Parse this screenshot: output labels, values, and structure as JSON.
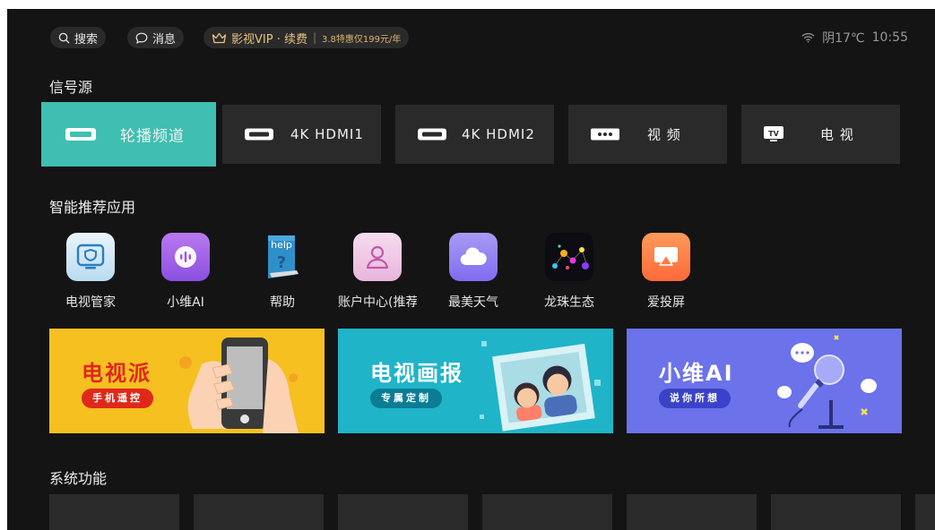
{
  "topbar": {
    "search_label": "搜索",
    "message_label": "消息",
    "vip_title": "影视VIP · 续费",
    "vip_offer": "3.8特惠仅199元/年",
    "weather": "阴17℃",
    "time": "10:55"
  },
  "sources": {
    "title": "信号源",
    "items": [
      {
        "label": "轮播频道",
        "icon": "hdmi-icon"
      },
      {
        "label": "4K HDMI1",
        "icon": "hdmi-icon"
      },
      {
        "label": "4K HDMI2",
        "icon": "hdmi-icon"
      },
      {
        "label": "视 频",
        "icon": "av-icon"
      },
      {
        "label": "电 视",
        "icon": "tv-icon"
      }
    ]
  },
  "apps": {
    "title": "智能推荐应用",
    "items": [
      {
        "name": "电视管家",
        "icon": "tv-manager-icon"
      },
      {
        "name": "小维AI",
        "icon": "voice-assistant-icon"
      },
      {
        "name": "帮助",
        "icon": "help-book-icon"
      },
      {
        "name": "账户中心(推荐",
        "icon": "account-icon"
      },
      {
        "name": "最美天气",
        "icon": "cloud-weather-icon"
      },
      {
        "name": "龙珠生态",
        "icon": "dragonball-icon"
      },
      {
        "name": "爱投屏",
        "icon": "screen-cast-icon"
      }
    ]
  },
  "banners": [
    {
      "title": "电视派",
      "subtitle": "手机遥控",
      "color": "#f6c021"
    },
    {
      "title": "电视画报",
      "subtitle": "专属定制",
      "color": "#1fb4c8"
    },
    {
      "title": "小维AI",
      "subtitle": "说你所想",
      "color": "#6b72ea"
    }
  ],
  "system": {
    "title": "系统功能"
  },
  "colors": {
    "accent": "#3fbfb1",
    "tile_bg": "#2a2a2a",
    "background": "#141414",
    "vip_gold": "#e8c27a"
  }
}
